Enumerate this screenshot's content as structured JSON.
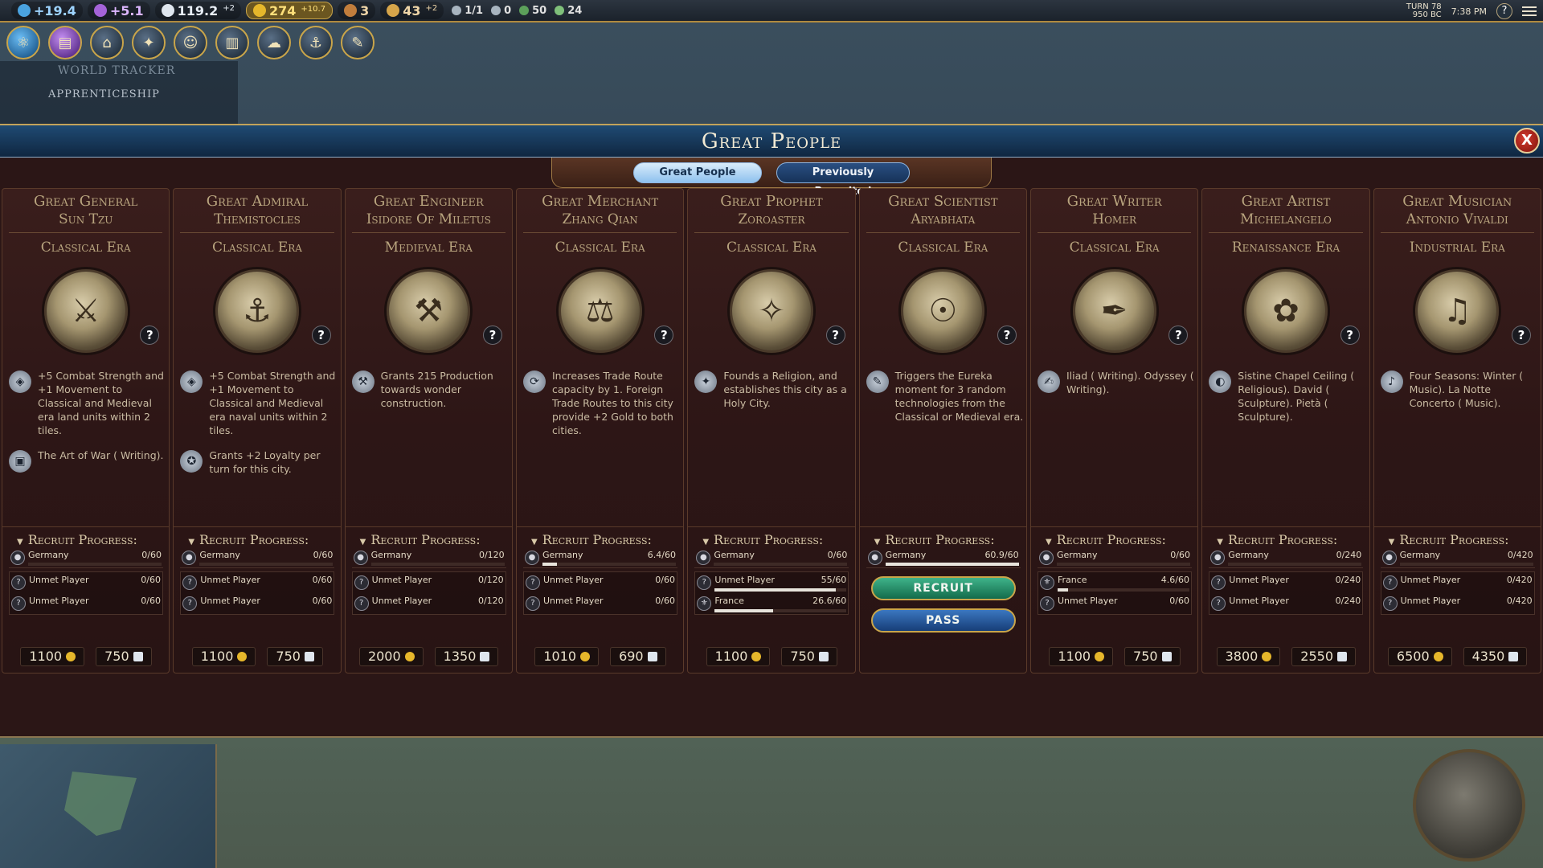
{
  "topbar": {
    "science": "+19.4",
    "culture": "+5.1",
    "faith": "119.2",
    "faith_delta": "+2",
    "gold": "274",
    "gold_delta": "+10.7",
    "tourism": "3",
    "favor": "43",
    "favor_delta": "+2",
    "trade_routes": "1/1",
    "strat1": "0",
    "strat2": "50",
    "strat3": "24",
    "turn": "TURN 78",
    "year": "950 BC",
    "time": "7:38 PM",
    "help": "?"
  },
  "tracker": {
    "title": "WORLD TRACKER",
    "subtitle": "APPRENTICESHIP"
  },
  "panel": {
    "title": "Great People",
    "close": "X",
    "tabs": [
      {
        "label": "Great People",
        "active": true
      },
      {
        "label": "Previously Recruited",
        "active": false
      }
    ]
  },
  "labels": {
    "recruit_progress": "Recruit Progress:",
    "recruit_btn": "RECRUIT",
    "pass_btn": "PASS",
    "info": "?"
  },
  "cards": [
    {
      "type": "Great General",
      "name": "Sun Tzu",
      "era": "Classical Era",
      "abilities": [
        "+5 Combat Strength and +1 Movement to Classical and Medieval era land units within 2 tiles.",
        "The Art of War ( Writing)."
      ],
      "player": {
        "name": "Germany",
        "value": "0/60",
        "progress": 0
      },
      "others": [
        {
          "name": "Unmet Player",
          "value": "0/60",
          "progress": 0
        },
        {
          "name": "Unmet Player",
          "value": "0/60",
          "progress": 0
        }
      ],
      "gold_cost": "1100",
      "faith_cost": "750"
    },
    {
      "type": "Great Admiral",
      "name": "Themistocles",
      "era": "Classical Era",
      "abilities": [
        "+5 Combat Strength and +1 Movement to Classical and Medieval era naval units within 2 tiles.",
        "Grants +2 Loyalty per turn for this city."
      ],
      "player": {
        "name": "Germany",
        "value": "0/60",
        "progress": 0
      },
      "others": [
        {
          "name": "Unmet Player",
          "value": "0/60",
          "progress": 0
        },
        {
          "name": "Unmet Player",
          "value": "0/60",
          "progress": 0
        }
      ],
      "gold_cost": "1100",
      "faith_cost": "750"
    },
    {
      "type": "Great Engineer",
      "name": "Isidore Of Miletus",
      "era": "Medieval Era",
      "abilities": [
        "Grants 215 Production towards wonder construction."
      ],
      "player": {
        "name": "Germany",
        "value": "0/120",
        "progress": 0
      },
      "others": [
        {
          "name": "Unmet Player",
          "value": "0/120",
          "progress": 0
        },
        {
          "name": "Unmet Player",
          "value": "0/120",
          "progress": 0
        }
      ],
      "gold_cost": "2000",
      "faith_cost": "1350"
    },
    {
      "type": "Great Merchant",
      "name": "Zhang Qian",
      "era": "Classical Era",
      "abilities": [
        "Increases Trade Route capacity by 1. Foreign Trade Routes to this city provide +2 Gold to both cities."
      ],
      "player": {
        "name": "Germany",
        "value": "6.4/60",
        "progress": 0.107
      },
      "others": [
        {
          "name": "Unmet Player",
          "value": "0/60",
          "progress": 0
        },
        {
          "name": "Unmet Player",
          "value": "0/60",
          "progress": 0
        }
      ],
      "gold_cost": "1010",
      "faith_cost": "690"
    },
    {
      "type": "Great Prophet",
      "name": "Zoroaster",
      "era": "Classical Era",
      "abilities": [
        "Founds a Religion, and establishes this city as a Holy City."
      ],
      "player": {
        "name": "Germany",
        "value": "0/60",
        "progress": 0
      },
      "others": [
        {
          "name": "Unmet Player",
          "value": "55/60",
          "progress": 0.917
        },
        {
          "name": "France",
          "value": "26.6/60",
          "progress": 0.443
        }
      ],
      "gold_cost": "1100",
      "faith_cost": "750"
    },
    {
      "type": "Great Scientist",
      "name": "Aryabhata",
      "era": "Classical Era",
      "abilities": [
        "Triggers the Eureka moment for 3 random technologies from the Classical or Medieval era."
      ],
      "player": {
        "name": "Germany",
        "value": "60.9/60",
        "progress": 1
      },
      "recruitable": true
    },
    {
      "type": "Great Writer",
      "name": "Homer",
      "era": "Classical Era",
      "abilities": [
        "Iliad ( Writing). Odyssey ( Writing)."
      ],
      "player": {
        "name": "Germany",
        "value": "0/60",
        "progress": 0
      },
      "others": [
        {
          "name": "France",
          "value": "4.6/60",
          "progress": 0.077
        },
        {
          "name": "Unmet Player",
          "value": "0/60",
          "progress": 0
        }
      ],
      "gold_cost": "1100",
      "faith_cost": "750"
    },
    {
      "type": "Great Artist",
      "name": "Michelangelo",
      "era": "Renaissance Era",
      "abilities": [
        "Sistine Chapel Ceiling ( Religious). David ( Sculpture). Pietà ( Sculpture)."
      ],
      "player": {
        "name": "Germany",
        "value": "0/240",
        "progress": 0
      },
      "others": [
        {
          "name": "Unmet Player",
          "value": "0/240",
          "progress": 0
        },
        {
          "name": "Unmet Player",
          "value": "0/240",
          "progress": 0
        }
      ],
      "gold_cost": "3800",
      "faith_cost": "2550"
    },
    {
      "type": "Great Musician",
      "name": "Antonio Vivaldi",
      "era": "Industrial Era",
      "abilities": [
        "Four Seasons: Winter ( Music). La Notte Concerto ( Music)."
      ],
      "player": {
        "name": "Germany",
        "value": "0/420",
        "progress": 0
      },
      "others": [
        {
          "name": "Unmet Player",
          "value": "0/420",
          "progress": 0
        },
        {
          "name": "Unmet Player",
          "value": "0/420",
          "progress": 0
        }
      ],
      "gold_cost": "6500",
      "faith_cost": "4350"
    }
  ],
  "colors": {
    "panel_bg": "#2b1616",
    "title_blue": "#1f4a73",
    "gold": "#c9a54a",
    "recruit_green": "#136b4b",
    "pass_blue": "#173e78"
  }
}
